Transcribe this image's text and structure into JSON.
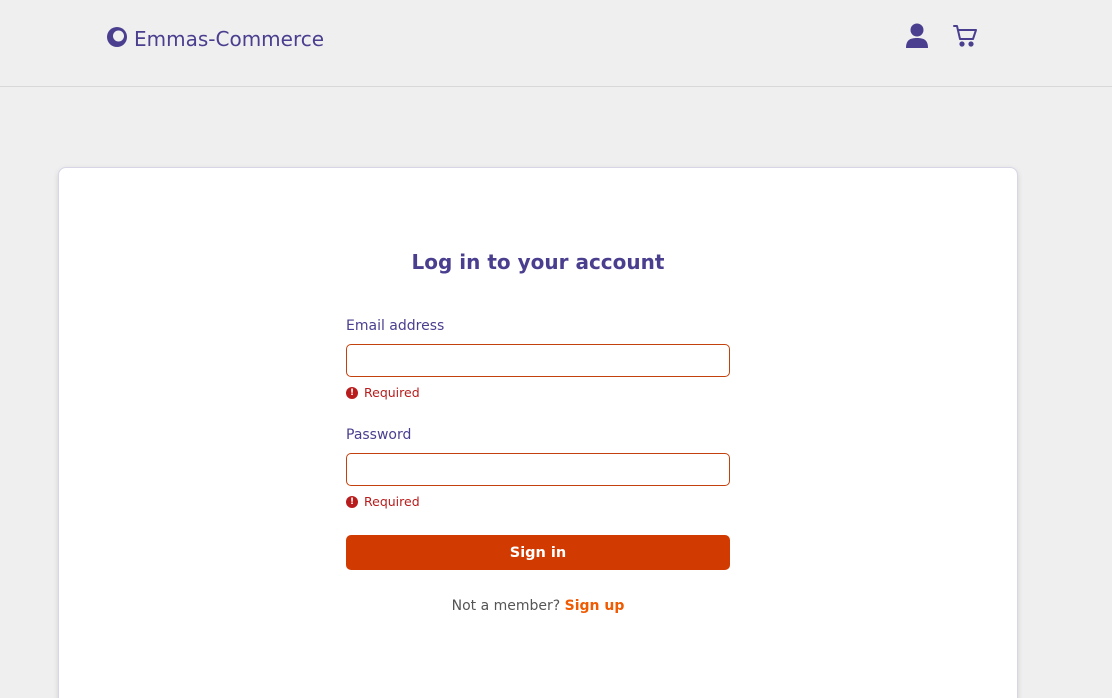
{
  "header": {
    "brand_name": "Emmas-Commerce",
    "icons": [
      "user-icon",
      "shopping-cart-icon"
    ]
  },
  "login": {
    "title": "Log in to your account",
    "email_label": "Email address",
    "email_value": "",
    "email_error": "Required",
    "password_label": "Password",
    "password_value": "",
    "password_error": "Required",
    "signin_label": "Sign in",
    "not_member_text": "Not a member?",
    "signup_label": "Sign up"
  },
  "colors": {
    "brand": "#4a3f8f",
    "primary_button": "#d13a00",
    "error": "#b91c1c",
    "link": "#f05a00",
    "background": "#efefef"
  }
}
